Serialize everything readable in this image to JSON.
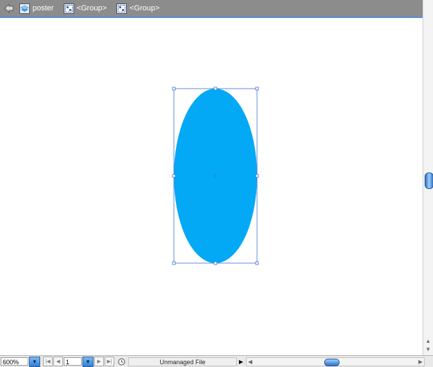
{
  "breadcrumb": {
    "items": [
      {
        "label": "poster",
        "icon": "layer-icon"
      },
      {
        "label": "<Group>",
        "icon": "group-icon"
      },
      {
        "label": "<Group>",
        "icon": "group-icon"
      }
    ]
  },
  "canvas": {
    "shape": "ellipse",
    "fill_color": "#03a9f4",
    "selection_color": "#3b6ed6"
  },
  "statusbar": {
    "zoom": "600%",
    "page": "1",
    "status_text": "Unmanaged File"
  }
}
